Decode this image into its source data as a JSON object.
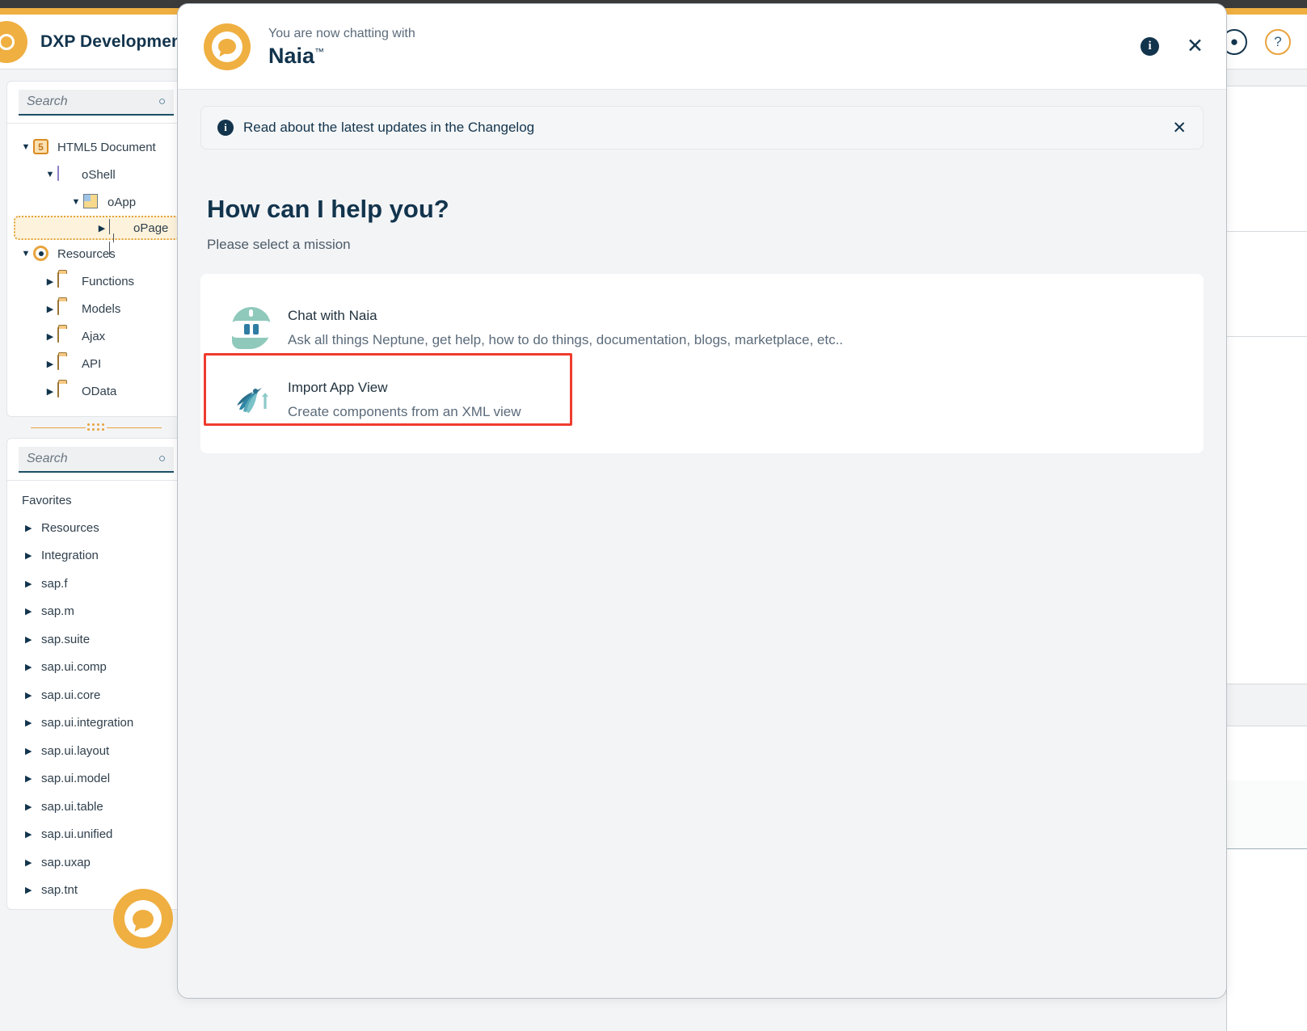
{
  "app": {
    "brand_title": "DXP Development",
    "help_icon": "question-mark-icon",
    "logo_icon": "dxp-logo-icon"
  },
  "sidebar": {
    "tree_search": {
      "placeholder": "Search",
      "value": "",
      "icon": "search-icon"
    },
    "tree": [
      {
        "label": "HTML5 Document",
        "icon": "html5-icon",
        "state": "expanded",
        "depth": 0,
        "selected": false
      },
      {
        "label": "oShell",
        "icon": "shell-icon",
        "state": "expanded",
        "depth": 1,
        "selected": false
      },
      {
        "label": "oApp",
        "icon": "app-icon",
        "state": "expanded",
        "depth": 2,
        "selected": false
      },
      {
        "label": "oPage",
        "icon": "page-icon",
        "state": "collapsed",
        "depth": 3,
        "selected": true
      },
      {
        "label": "Resources",
        "icon": "gear-icon",
        "state": "expanded",
        "depth": 0,
        "selected": false
      },
      {
        "label": "Functions",
        "icon": "folder-icon",
        "state": "collapsed",
        "depth": 1,
        "selected": false
      },
      {
        "label": "Models",
        "icon": "folder-icon",
        "state": "collapsed",
        "depth": 1,
        "selected": false
      },
      {
        "label": "Ajax",
        "icon": "folder-icon",
        "state": "collapsed",
        "depth": 1,
        "selected": false
      },
      {
        "label": "API",
        "icon": "folder-icon",
        "state": "collapsed",
        "depth": 1,
        "selected": false
      },
      {
        "label": "OData",
        "icon": "folder-icon",
        "state": "collapsed",
        "depth": 1,
        "selected": false
      }
    ],
    "library_search": {
      "placeholder": "Search",
      "value": "",
      "icon": "search-icon"
    },
    "library_header": "Favorites",
    "library": [
      {
        "label": "Resources"
      },
      {
        "label": "Integration"
      },
      {
        "label": "sap.f"
      },
      {
        "label": "sap.m"
      },
      {
        "label": "sap.suite"
      },
      {
        "label": "sap.ui.comp"
      },
      {
        "label": "sap.ui.core"
      },
      {
        "label": "sap.ui.integration"
      },
      {
        "label": "sap.ui.layout"
      },
      {
        "label": "sap.ui.model"
      },
      {
        "label": "sap.ui.table"
      },
      {
        "label": "sap.ui.unified"
      },
      {
        "label": "sap.uxap"
      },
      {
        "label": "sap.tnt"
      }
    ]
  },
  "chat_fab": {
    "icon": "chat-bubble-icon"
  },
  "modal": {
    "header": {
      "subtitle": "You are now chatting with",
      "title": "Naia",
      "trademark": "™",
      "avatar_icon": "naia-avatar-icon",
      "info_icon": "info-icon",
      "close_icon": "close-icon"
    },
    "banner": {
      "icon": "info-circle-icon",
      "text": "Read about the latest updates in the Changelog",
      "dismiss_icon": "close-icon"
    },
    "heading": "How can I help you?",
    "subheading": "Please select a mission",
    "missions": [
      {
        "title": "Chat with Naia",
        "description": "Ask all things Neptune, get help, how to do things, documentation, blogs, marketplace, etc..",
        "icon": "robot-icon",
        "highlighted": false
      },
      {
        "title": "Import App View",
        "description": "Create components from an XML view",
        "icon": "phoenix-import-icon",
        "highlighted": true
      }
    ]
  },
  "colors": {
    "brand_orange": "#efaf41",
    "dark_navy": "#12344d",
    "highlight_red": "#ef3b2d",
    "robot_teal": "#8fc9bb",
    "phoenix_blue": "#2b7c96"
  }
}
